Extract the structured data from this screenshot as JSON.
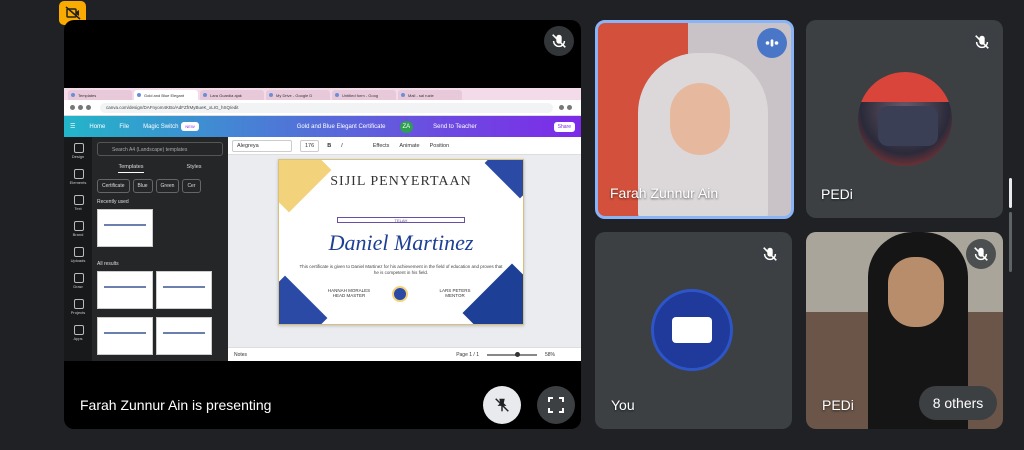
{
  "presenting_label": "Farah Zunnur Ain is presenting",
  "screen": {
    "tabs": [
      "Templates",
      "Gold and Blue Elegant",
      "Lara Guardia ajak",
      "My Drive - Google D",
      "Untitled form - Goog",
      "Mail - sal ruzle"
    ],
    "url": "canva.com/design/DAFnyom4KBo/AdFZfrMyBueK_xLIG_hSQ/edit",
    "canva_menu": [
      "Home",
      "File",
      "Magic Switch"
    ],
    "canva_badge": "NEW",
    "doc_title": "Gold and Blue Elegant Certificate",
    "avatar_initials": "ZA",
    "send_to_teacher": "Send to Teacher",
    "share": "Share",
    "side_items": [
      "Design",
      "Elements",
      "Text",
      "Brand",
      "Uploads",
      "Draw",
      "Projects",
      "Apps"
    ],
    "search_placeholder": "Search A4 (Landscape) templates",
    "panel_tabs": [
      "Templates",
      "Styles"
    ],
    "chips": [
      "Certificate",
      "Blue",
      "Green",
      "Cer"
    ],
    "recently_used": "Recently used",
    "all_results": "All results",
    "font_name": "Alegreya",
    "font_size": "176",
    "toolbar": [
      "Effects",
      "Animate",
      "Position"
    ],
    "cert_title": "SIJIL PENYERTAAN",
    "cert_ribbon": "TELAH",
    "cert_name": "Daniel Martinez",
    "cert_text": "This certificate is given to Daniel Martinez for his achievement in the field of education and proves that he is competent in his field.",
    "cert_sig1_name": "HANNAH MORALES",
    "cert_sig1_role": "HEAD MASTER",
    "cert_sig2_name": "LARS PETERS",
    "cert_sig2_role": "MENTOR",
    "notes": "Notes",
    "page": "Page 1 / 1",
    "zoom": "58%"
  },
  "participants": [
    {
      "name": "Farah Zunnur Ain",
      "speaking": true
    },
    {
      "name": "PEDi",
      "muted": true
    },
    {
      "name": "You",
      "muted": true
    },
    {
      "name": "PEDi",
      "muted": true
    }
  ],
  "others": "8 others",
  "colors": {
    "background": "#202124",
    "tile": "#3c4043",
    "speaking_border": "#8ab4f8",
    "warning": "#f9ab00"
  }
}
